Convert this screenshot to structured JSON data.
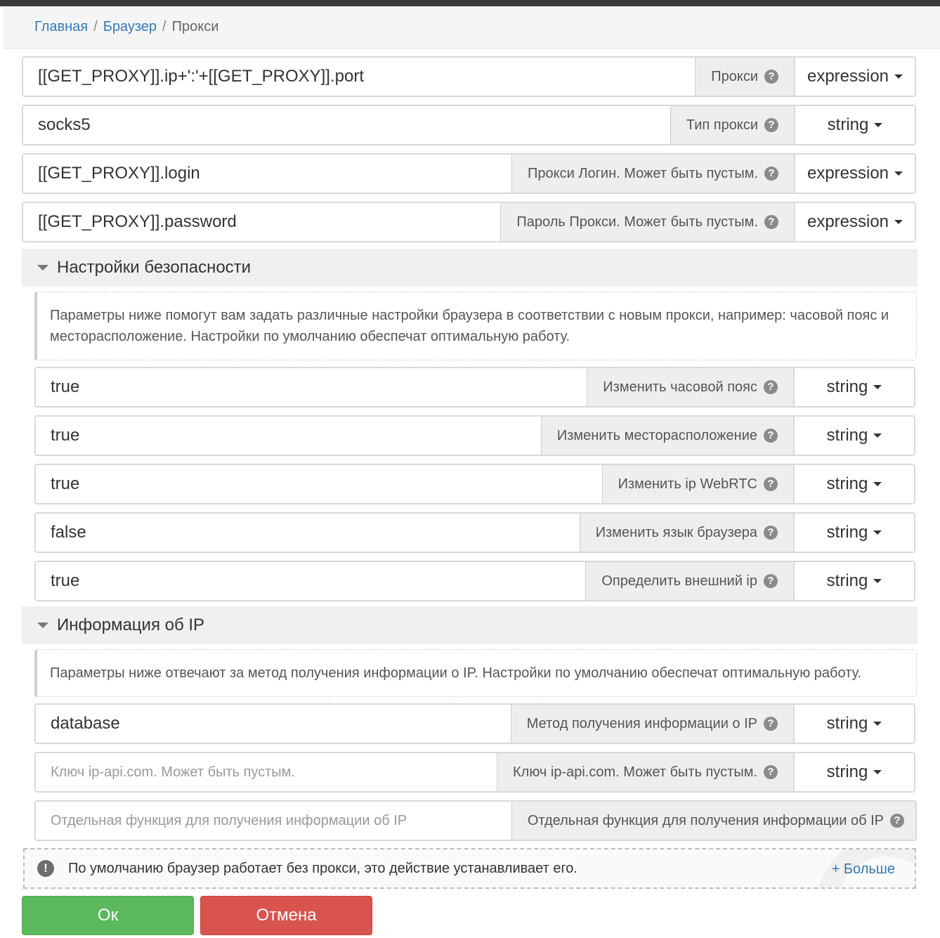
{
  "breadcrumb": {
    "home": "Главная",
    "browser": "Браузер",
    "current": "Прокси",
    "sep": "/"
  },
  "fields": [
    {
      "value": "[[GET_PROXY]].ip+':'+[[GET_PROXY]].port",
      "label": "Прокси",
      "type": "expression"
    },
    {
      "value": "socks5",
      "label": "Тип прокси",
      "type": "string"
    },
    {
      "value": "[[GET_PROXY]].login",
      "label": "Прокси Логин. Может быть пустым.",
      "type": "expression"
    },
    {
      "value": "[[GET_PROXY]].password",
      "label": "Пароль Прокси. Может быть пустым.",
      "type": "expression"
    }
  ],
  "security": {
    "title": "Настройки безопасности",
    "note": "Параметры ниже помогут вам задать различные настройки браузера в соответствии с новым прокси, например: часовой пояс и месторасположение. Настройки по умолчанию обеспечат оптимальную работу.",
    "fields": [
      {
        "value": "true",
        "label": "Изменить часовой пояс",
        "type": "string"
      },
      {
        "value": "true",
        "label": "Изменить месторасположение",
        "type": "string"
      },
      {
        "value": "true",
        "label": "Изменить ip WebRTC",
        "type": "string"
      },
      {
        "value": "false",
        "label": "Изменить язык браузера",
        "type": "string"
      },
      {
        "value": "true",
        "label": "Определить внешний ip",
        "type": "string"
      }
    ]
  },
  "ipinfo": {
    "title": "Информация об IP",
    "note": "Параметры ниже отвечают за метод получения информации о IP. Настройки по умолчанию обеспечат оптимальную работу.",
    "fields": [
      {
        "value": "database",
        "label": "Метод получения информации о IP",
        "type": "string"
      },
      {
        "placeholder": "Ключ ip-api.com. Может быть пустым.",
        "label": "Ключ ip-api.com. Может быть пустым.",
        "type": "string"
      },
      {
        "placeholder": "Отдельная функция для получения информации об IP",
        "label": "Отдельная функция для получения информации об IP"
      }
    ]
  },
  "footer": {
    "text": "По умолчанию браузер работает без прокси, это действие устанавливает его.",
    "more": "+ Больше"
  },
  "buttons": {
    "ok": "Ок",
    "cancel": "Отмена"
  },
  "icons": {
    "help": "question-circle-icon",
    "warning": "exclamation-circle-icon",
    "collapse": "caret-down-icon"
  },
  "colors": {
    "ok": "#5cb85c",
    "cancel": "#d9534f",
    "link": "#337ab7"
  }
}
